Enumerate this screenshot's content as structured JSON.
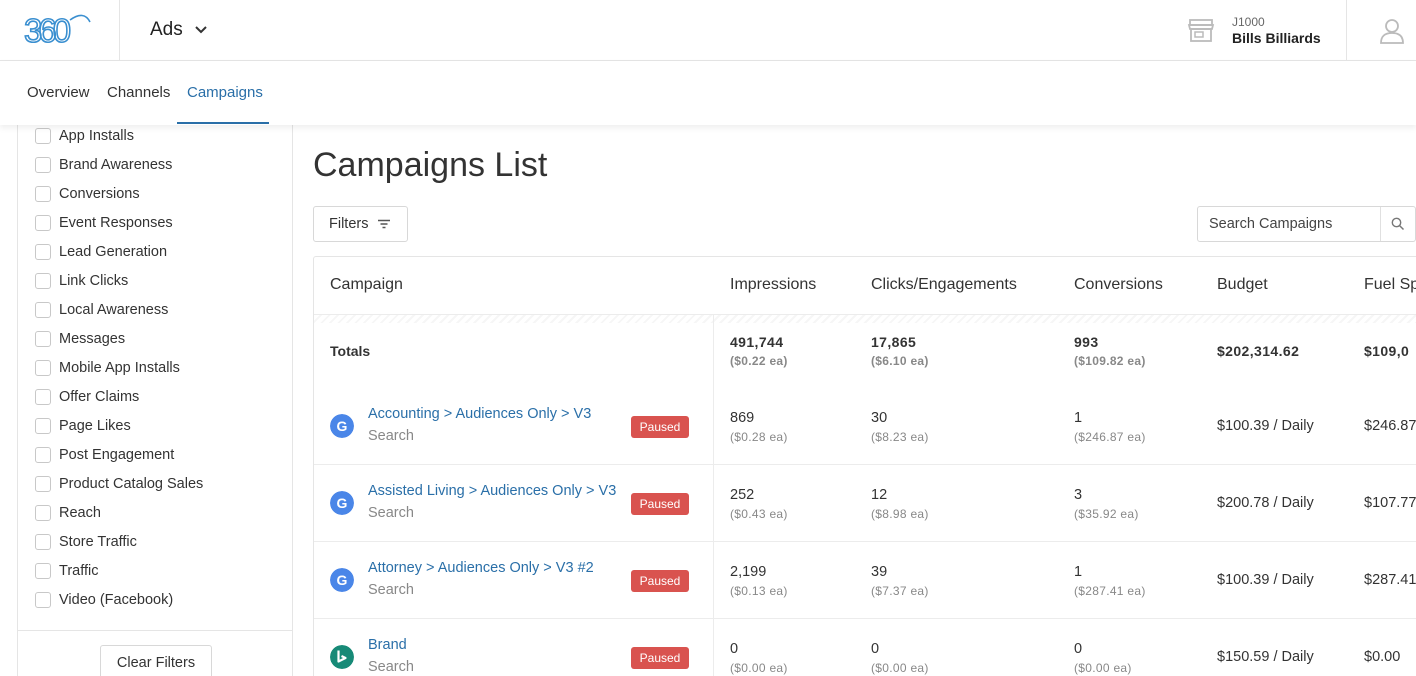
{
  "header": {
    "app_name": "Ads",
    "account_id": "J1000",
    "account_name": "Bills Billiards",
    "logo_icon": "360-logo",
    "store_icon": "storefront-icon",
    "user_icon": "user-icon"
  },
  "tabs": [
    {
      "label": "Overview"
    },
    {
      "label": "Channels"
    },
    {
      "label": "Campaigns",
      "active": true
    }
  ],
  "sidebar": {
    "filters": [
      "App Installs",
      "Brand Awareness",
      "Conversions",
      "Event Responses",
      "Lead Generation",
      "Link Clicks",
      "Local Awareness",
      "Messages",
      "Mobile App Installs",
      "Offer Claims",
      "Page Likes",
      "Post Engagement",
      "Product Catalog Sales",
      "Reach",
      "Store Traffic",
      "Traffic",
      "Video (Facebook)"
    ],
    "clear_label": "Clear Filters"
  },
  "main": {
    "title": "Campaigns List",
    "filters_label": "Filters",
    "search_placeholder": "Search Campaigns",
    "columns": [
      "Campaign",
      "Impressions",
      "Clicks/Engagements",
      "Conversions",
      "Budget",
      "Fuel Sp"
    ],
    "totals": {
      "label": "Totals",
      "impressions": "491,744",
      "impressions_ea": "($0.22 ea)",
      "clicks": "17,865",
      "clicks_ea": "($6.10 ea)",
      "conversions": "993",
      "conversions_ea": "($109.82 ea)",
      "budget": "$202,314.62",
      "fuel": "$109,0"
    },
    "rows": [
      {
        "channel": "google",
        "name": "Accounting > Audiences Only > V3",
        "type": "Search",
        "status": "Paused",
        "impressions": "869",
        "impressions_ea": "($0.28 ea)",
        "clicks": "30",
        "clicks_ea": "($8.23 ea)",
        "conversions": "1",
        "conversions_ea": "($246.87 ea)",
        "budget": "$100.39 / Daily",
        "fuel": "$246.87"
      },
      {
        "channel": "google",
        "name": "Assisted Living > Audiences Only > V3",
        "type": "Search",
        "status": "Paused",
        "impressions": "252",
        "impressions_ea": "($0.43 ea)",
        "clicks": "12",
        "clicks_ea": "($8.98 ea)",
        "conversions": "3",
        "conversions_ea": "($35.92 ea)",
        "budget": "$200.78 / Daily",
        "fuel": "$107.77"
      },
      {
        "channel": "google",
        "name": "Attorney > Audiences Only > V3 #2",
        "type": "Search",
        "status": "Paused",
        "impressions": "2,199",
        "impressions_ea": "($0.13 ea)",
        "clicks": "39",
        "clicks_ea": "($7.37 ea)",
        "conversions": "1",
        "conversions_ea": "($287.41 ea)",
        "budget": "$100.39 / Daily",
        "fuel": "$287.41"
      },
      {
        "channel": "bing",
        "name": "Brand",
        "type": "Search",
        "status": "Paused",
        "impressions": "0",
        "impressions_ea": "($0.00 ea)",
        "clicks": "0",
        "clicks_ea": "($0.00 ea)",
        "conversions": "0",
        "conversions_ea": "($0.00 ea)",
        "budget": "$150.59 / Daily",
        "fuel": "$0.00"
      }
    ]
  },
  "colors": {
    "accent": "#2a6fa8",
    "paused_badge": "#d9534f",
    "google_icon": "#4a86e8",
    "bing_icon": "#178a77"
  }
}
